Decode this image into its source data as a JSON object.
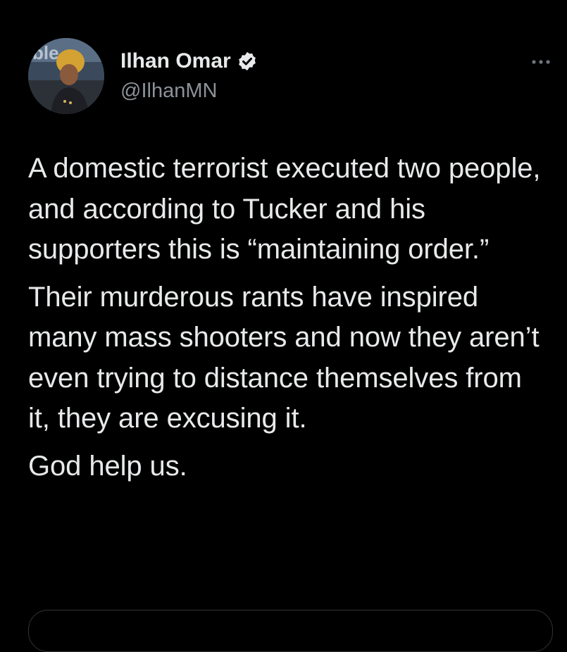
{
  "author": {
    "display_name": "Ilhan Omar",
    "handle": "@IlhanMN",
    "verified": true,
    "avatar_icon": "profile-photo-avatar"
  },
  "tweet": {
    "paragraphs": [
      "A domestic terrorist executed two people, and according to Tucker and his supporters this is “maintaining order.”",
      "Their murderous rants have inspired many mass shooters and now they aren’t even trying to distance themselves from it, they are excusing it.",
      "God help us."
    ]
  },
  "icons": {
    "verified": "verified-badge-icon",
    "more": "more-options-icon"
  },
  "colors": {
    "background": "#000000",
    "text": "#e7e9ea",
    "secondary_text": "#8b9299"
  }
}
